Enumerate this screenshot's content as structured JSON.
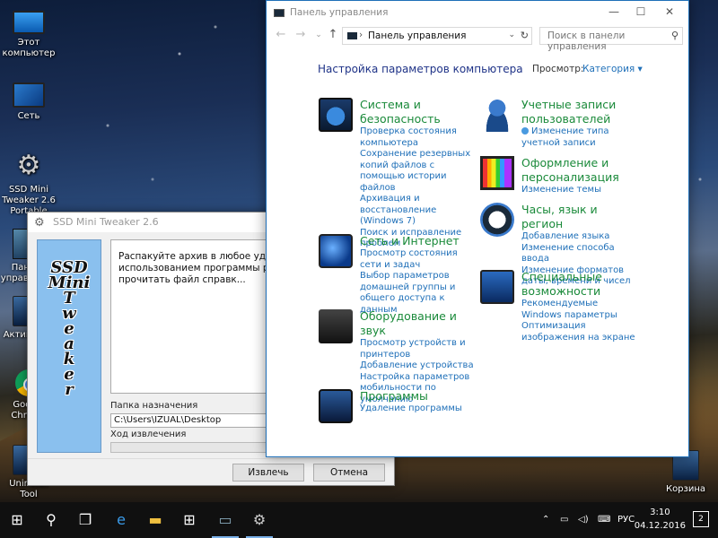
{
  "desktop": {
    "icons": [
      {
        "label": "Этот компьютер"
      },
      {
        "label": "Сеть"
      },
      {
        "label": "SSD Mini Tweaker 2.6 Portable"
      },
      {
        "label": "Панель управления"
      },
      {
        "label": "Активация"
      },
      {
        "label": "Google Chrome"
      },
      {
        "label": "Uninstall Tool"
      },
      {
        "label": "Корзина"
      }
    ]
  },
  "ssd_window": {
    "title": "SSD Mini Tweaker 2.6",
    "logo_letters": [
      "SSD",
      "Mini",
      "T",
      "w",
      "e",
      "a",
      "k",
      "e",
      "r"
    ],
    "description": "Распакуйте архив в любое удобное д... Перед использованием программы р... внимательно прочитать файл справк...",
    "dest_label": "Папка назначения",
    "dest_value": "C:\\Users\\IZUAL\\Desktop",
    "progress_label": "Ход извлечения",
    "progress": 0,
    "extract_label": "Извлечь",
    "cancel_label": "Отмена"
  },
  "control_panel": {
    "title": "Панель управления",
    "address": "Панель управления",
    "search_placeholder": "Поиск в панели управления",
    "heading": "Настройка параметров компьютера",
    "view_by_label": "Просмотр:",
    "view_by_value": "Категория ▾",
    "left": [
      {
        "icon": "system-security",
        "title": "Система и безопасность",
        "links": [
          "Проверка состояния компьютера",
          "Сохранение резервных копий файлов с помощью истории файлов",
          "Архивация и восстановление (Windows 7)",
          "Поиск и исправление проблем"
        ]
      },
      {
        "icon": "network-internet",
        "title": "Сеть и Интернет",
        "links": [
          "Просмотр состояния сети и задач",
          "Выбор параметров домашней группы и общего доступа к данным"
        ]
      },
      {
        "icon": "hardware-sound",
        "title": "Оборудование и звук",
        "links": [
          "Просмотр устройств и принтеров",
          "Добавление устройства",
          "Настройка параметров мобильности по умолчанию"
        ]
      },
      {
        "icon": "programs",
        "title": "Программы",
        "links": [
          "Удаление программы"
        ]
      }
    ],
    "right": [
      {
        "icon": "user-accounts",
        "title": "Учетные записи пользователей",
        "links": [
          "Изменение типа учетной записи"
        ]
      },
      {
        "icon": "appearance",
        "title": "Оформление и персонализация",
        "links": [
          "Изменение темы"
        ]
      },
      {
        "icon": "clock-region",
        "title": "Часы, язык и регион",
        "links": [
          "Добавление языка",
          "Изменение способа ввода",
          "Изменение форматов даты, времени и чисел"
        ]
      },
      {
        "icon": "ease-of-access",
        "title": "Специальные возможности",
        "links": [
          "Рекомендуемые Windows параметры",
          "Оптимизация изображения на экране"
        ]
      }
    ]
  },
  "taskbar": {
    "lang": "РУС",
    "time": "3:10",
    "date": "04.12.2016",
    "notifications": "2"
  }
}
